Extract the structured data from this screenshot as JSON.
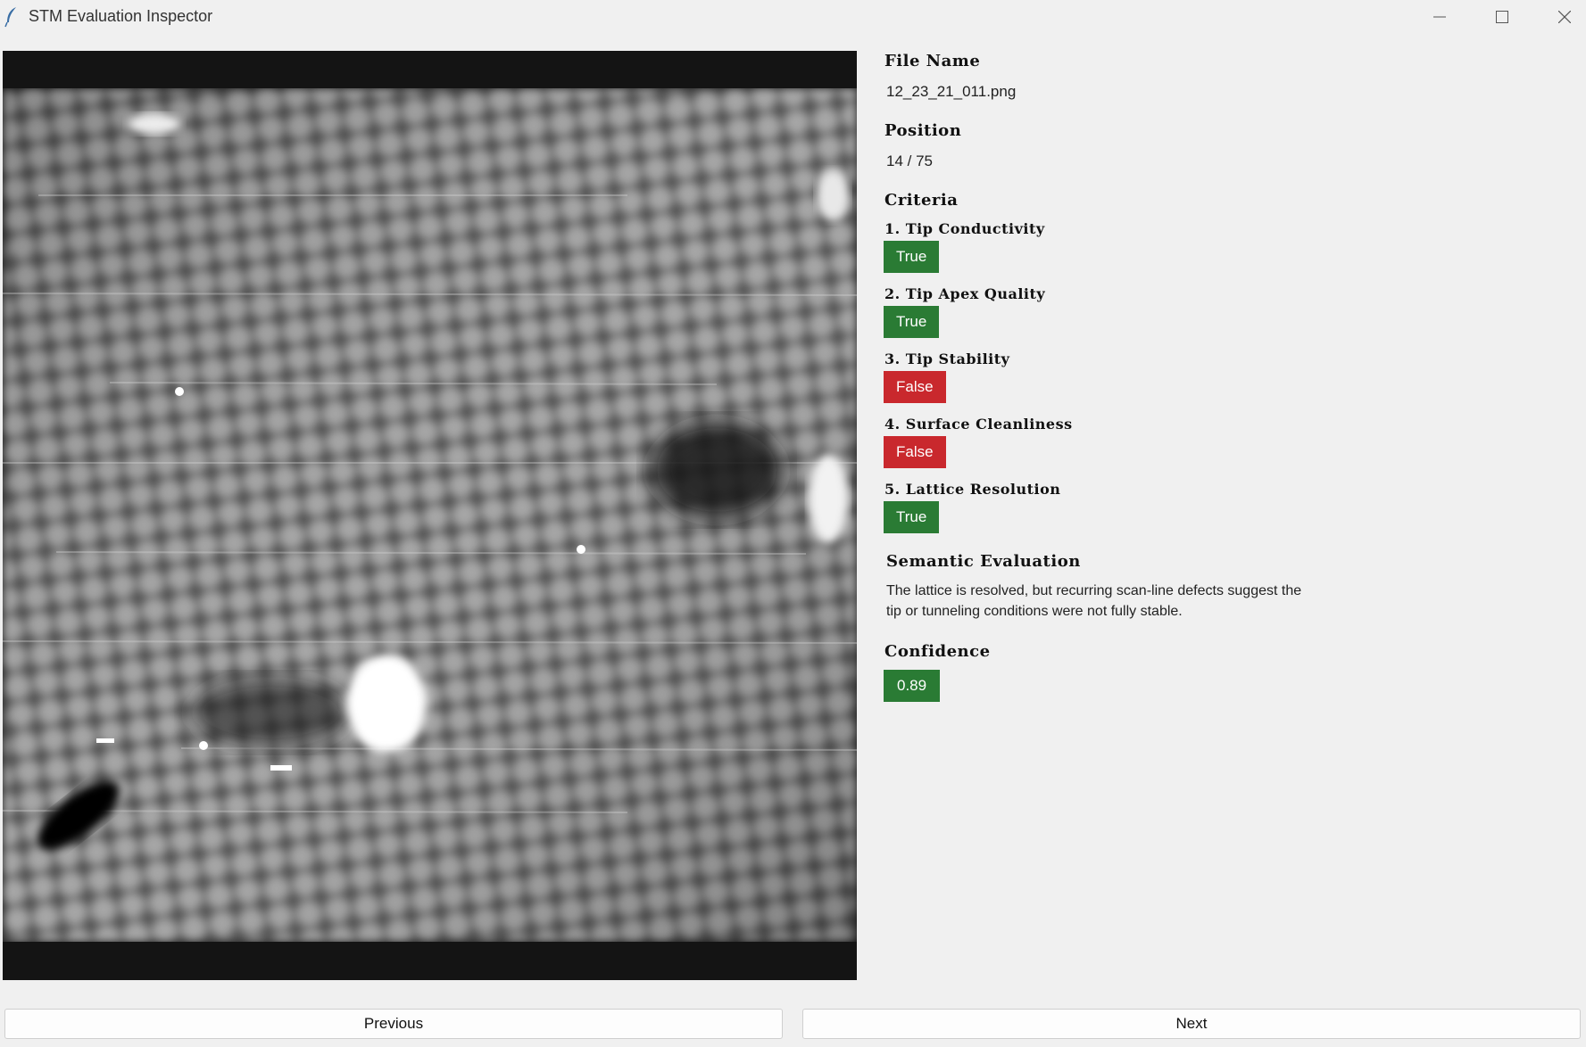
{
  "window": {
    "title": "STM Evaluation Inspector",
    "icon": "feather-icon",
    "controls": [
      "minimize-icon",
      "maximize-icon",
      "close-icon"
    ]
  },
  "details": {
    "file_name_label": "File Name",
    "file_name": "12_23_21_011.png",
    "position_label": "Position",
    "position": "14 / 75",
    "criteria_label": "Criteria",
    "criteria": [
      {
        "label": "1. Tip Conductivity",
        "value": "True",
        "color": "#2a7b34"
      },
      {
        "label": "2. Tip Apex Quality",
        "value": "True",
        "color": "#2a7b34"
      },
      {
        "label": "3. Tip Stability",
        "value": "False",
        "color": "#c9282d"
      },
      {
        "label": "4. Surface Cleanliness",
        "value": "False",
        "color": "#c9282d"
      },
      {
        "label": "5. Lattice Resolution",
        "value": "True",
        "color": "#2a7b34"
      }
    ],
    "semantic_label": "Semantic Evaluation",
    "semantic_line1": "The lattice is resolved, but recurring scan-line defects suggest the",
    "semantic_line2": "tip or tunneling conditions were not fully stable.",
    "confidence_label": "Confidence",
    "confidence": "0.89",
    "confidence_color": "#2a7b34"
  },
  "navigation": {
    "previous_label": "Previous",
    "next_label": "Next"
  },
  "colors": {
    "true": "#2a7b34",
    "false": "#c9282d",
    "background": "#f0f0f0",
    "image_border": "#141414"
  }
}
